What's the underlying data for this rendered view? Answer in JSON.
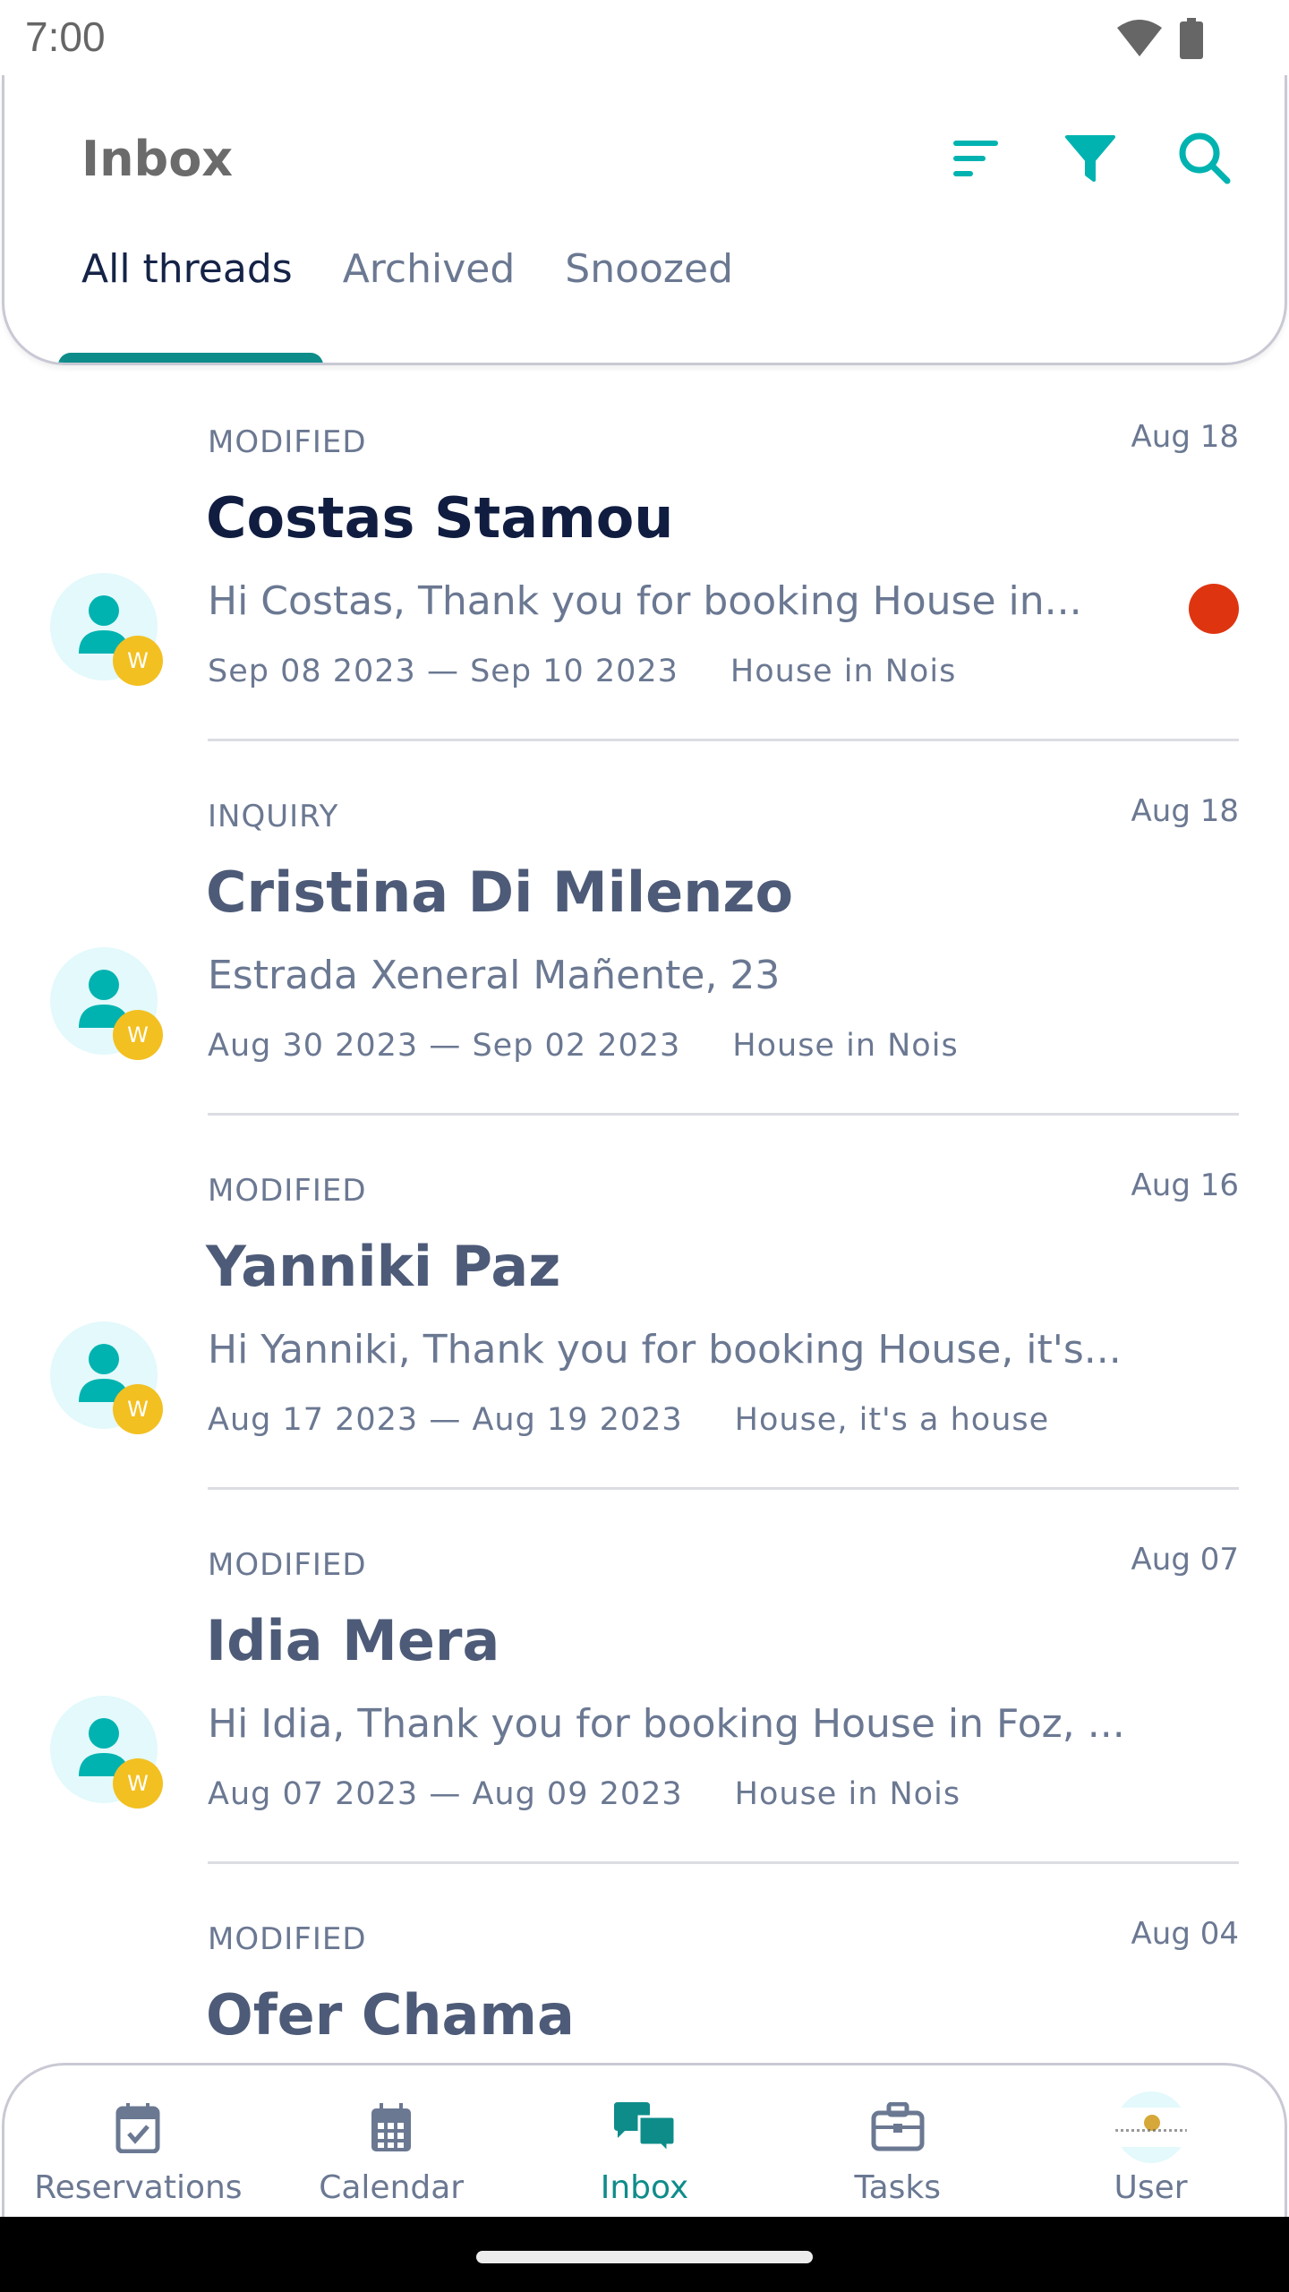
{
  "status_bar": {
    "time": "7:00",
    "icons": [
      "wifi-icon",
      "battery-icon"
    ]
  },
  "header": {
    "title": "Inbox",
    "actions": [
      {
        "name": "sort",
        "icon": "sort-icon"
      },
      {
        "name": "filter",
        "icon": "filter-icon"
      },
      {
        "name": "search",
        "icon": "search-icon"
      }
    ],
    "accent_color": "#00b3b0"
  },
  "tabs": [
    {
      "label": "All threads",
      "active": true
    },
    {
      "label": "Archived",
      "active": false
    },
    {
      "label": "Snoozed",
      "active": false
    }
  ],
  "threads": [
    {
      "status": "MODIFIED",
      "date": "Aug 18",
      "name": "Costas Stamou",
      "preview": "Hi Costas, Thank you for booking House in...",
      "dates": "Sep 08 2023 — Sep 10 2023",
      "property": "House in Nois",
      "unread": true,
      "badge": "W"
    },
    {
      "status": "INQUIRY",
      "date": "Aug 18",
      "name": "Cristina Di Milenzo",
      "preview": "Estrada Xeneral Mañente, 23",
      "dates": "Aug 30 2023 — Sep 02 2023",
      "property": "House in Nois",
      "unread": false,
      "badge": "W"
    },
    {
      "status": "MODIFIED",
      "date": "Aug 16",
      "name": "Yanniki Paz",
      "preview": "Hi Yanniki, Thank you for booking House, it's...",
      "dates": "Aug 17 2023 — Aug 19 2023",
      "property": "House, it's a house",
      "unread": false,
      "badge": "W"
    },
    {
      "status": "MODIFIED",
      "date": "Aug 07",
      "name": "Idia Mera",
      "preview": "Hi Idia, Thank you for booking House in Foz, ...",
      "dates": "Aug 07 2023 — Aug 09 2023",
      "property": "House in Nois",
      "unread": false,
      "badge": "W"
    },
    {
      "status": "MODIFIED",
      "date": "Aug 04",
      "name": "Ofer Chama",
      "preview": "",
      "dates": "",
      "property": "",
      "unread": false,
      "badge": "W"
    }
  ],
  "bottom_nav": [
    {
      "label": "Reservations",
      "icon": "calendar-check-icon",
      "active": false
    },
    {
      "label": "Calendar",
      "icon": "calendar-grid-icon",
      "active": false
    },
    {
      "label": "Inbox",
      "icon": "chat-bubbles-icon",
      "active": true
    },
    {
      "label": "Tasks",
      "icon": "briefcase-icon",
      "active": false
    },
    {
      "label": "User",
      "icon": "user-avatar-icon",
      "active": false
    }
  ],
  "colors": {
    "teal": "#0e8c8a",
    "accent": "#00b3b0",
    "unread_dot": "#de3510",
    "badge": "#f3c021",
    "avatar_bg": "#e3f9fb"
  }
}
